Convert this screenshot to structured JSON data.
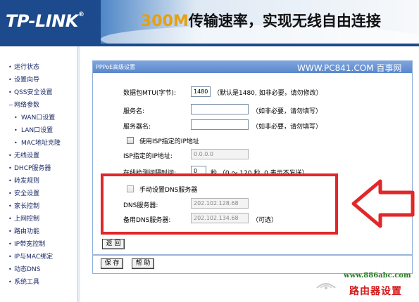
{
  "brand": {
    "logo": "TP-LINK",
    "logo_mark": "®",
    "banner_speed": "300M",
    "banner_slogan": "传输速率，实现无线自由连接"
  },
  "sidebar": {
    "items": [
      {
        "label": "运行状态",
        "sub": false
      },
      {
        "label": "设置向导",
        "sub": false
      },
      {
        "label": "QSS安全设置",
        "sub": false
      },
      {
        "label": "网络参数",
        "sub": false,
        "expanded": true
      },
      {
        "label": "WAN口设置",
        "sub": true
      },
      {
        "label": "LAN口设置",
        "sub": true
      },
      {
        "label": "MAC地址克隆",
        "sub": true
      },
      {
        "label": "无线设置",
        "sub": false
      },
      {
        "label": "DHCP服务器",
        "sub": false
      },
      {
        "label": "转发规则",
        "sub": false
      },
      {
        "label": "安全设置",
        "sub": false
      },
      {
        "label": "家长控制",
        "sub": false
      },
      {
        "label": "上网控制",
        "sub": false
      },
      {
        "label": "路由功能",
        "sub": false
      },
      {
        "label": "IP带宽控制",
        "sub": false
      },
      {
        "label": "IP与MAC绑定",
        "sub": false
      },
      {
        "label": "动态DNS",
        "sub": false
      },
      {
        "label": "系统工具",
        "sub": false
      }
    ]
  },
  "panel": {
    "title": "PPPoE高级设置",
    "watermark": "WWW.PC841.COM 百事网"
  },
  "form": {
    "mtu": {
      "label": "数据包MTU(字节):",
      "value": "1480",
      "hint": "（默认是1480, 如非必要，请勿修改）"
    },
    "service_name": {
      "label": "服务名:",
      "value": "",
      "hint": "（如非必要，请勿填写）"
    },
    "server_name": {
      "label": "服务器名:",
      "value": "",
      "hint": "（如非必要，请勿填写）"
    },
    "use_isp_ip": {
      "label": "使用ISP指定的IP地址",
      "checked": false
    },
    "isp_ip": {
      "label": "ISP指定的IP地址:",
      "value": "0.0.0.0"
    },
    "detect_interval": {
      "label": "在线检测间隔时间:",
      "value": "0",
      "hint": "秒 （0 ～ 120 秒, 0 表示不发送）"
    },
    "manual_dns": {
      "label": "手动设置DNS服务器",
      "checked": false
    },
    "dns": {
      "label": "DNS服务器:",
      "value": "202.102.128.68"
    },
    "dns_backup": {
      "label": "备用DNS服务器:",
      "value": "202.102.134.68",
      "hint": "（可选）"
    }
  },
  "buttons": {
    "back": "返 回",
    "save": "保 存",
    "help": "帮 助"
  },
  "footer": {
    "url": "www.886abc.com",
    "site_name": "路由器设置"
  },
  "colors": {
    "header_blue": "#1f4f92",
    "highlight_red": "#e1272a",
    "banner_orange": "#e6a010"
  }
}
